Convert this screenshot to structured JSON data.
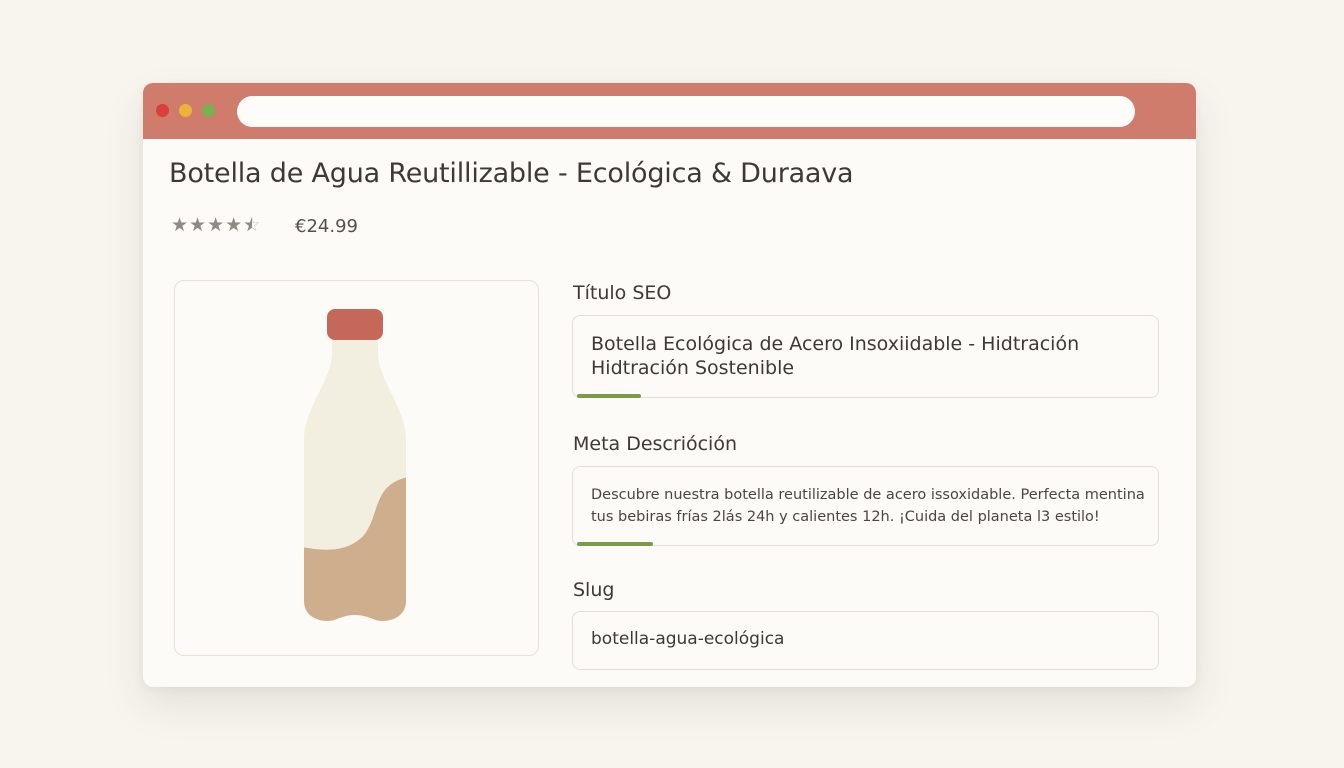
{
  "window": {
    "url": "",
    "colors": {
      "titlebar": "#d07c6c",
      "accent": "#7d9a4b"
    }
  },
  "product": {
    "title": "Botella de Agua Reutillizable - Ecológica & Duraava",
    "rating": 4.5,
    "rating_max": 5,
    "price": "€24.99"
  },
  "fields": {
    "seo": {
      "label": "Título SEO",
      "value": "Botella Ecológica de Acero Insoxiidable - Hidtración Hidtración Sostenible",
      "progress": 0.11
    },
    "meta": {
      "label": "Meta Descrióción",
      "value": "Descubre nuestra botella reutilizable de acero issoxidable. Perfecta mentina tus bebiras frías 2lás 24h y calientes 12h. ¡Cuida del planeta l3 estilo!",
      "progress": 0.13
    },
    "slug": {
      "label": "Slug",
      "value": "botella-agua-ecológica"
    }
  },
  "icons": {
    "close": "red-dot-icon",
    "minimize": "yellow-dot-icon",
    "maximize": "green-dot-icon",
    "rating": "star-icon",
    "product_image": "bottle-icon"
  }
}
